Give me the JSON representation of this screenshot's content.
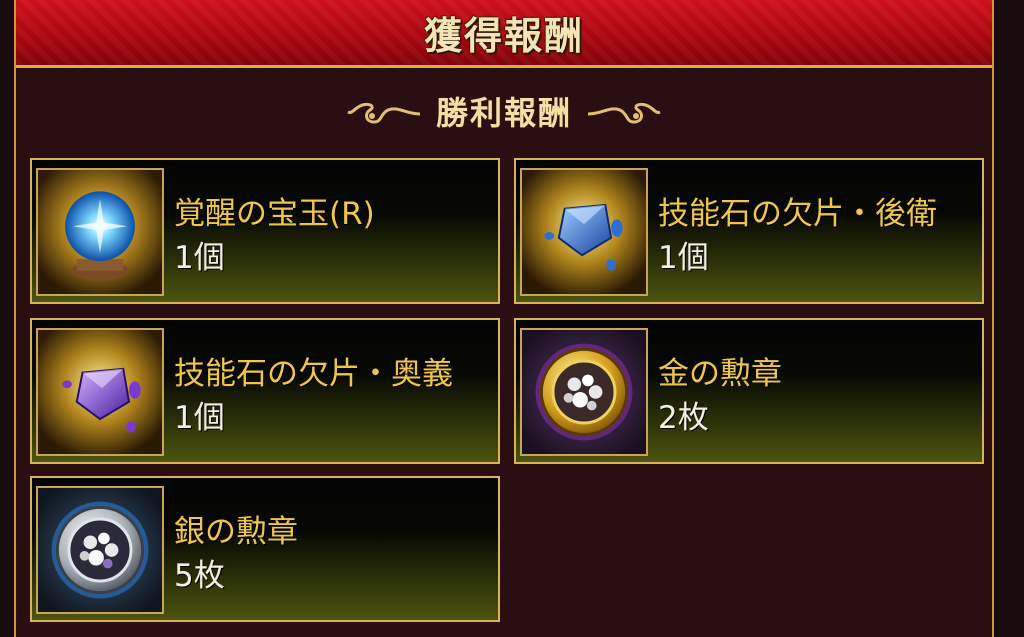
{
  "header": {
    "title": "獲得報酬"
  },
  "section": {
    "title": "勝利報酬"
  },
  "rewards": [
    {
      "name": "覚醒の宝玉(R)",
      "quantity": "1個",
      "icon": "blue-orb-icon"
    },
    {
      "name": "技能石の欠片・後衛",
      "quantity": "1個",
      "icon": "blue-crystal-icon"
    },
    {
      "name": "技能石の欠片・奥義",
      "quantity": "1個",
      "icon": "purple-crystal-icon"
    },
    {
      "name": "金の勲章",
      "quantity": "2枚",
      "icon": "gold-medal-icon"
    },
    {
      "name": "銀の勲章",
      "quantity": "5枚",
      "icon": "silver-medal-icon"
    }
  ],
  "colors": {
    "header_red": "#c00812",
    "gold_border": "#d7b35a",
    "item_name": "#f0c64a",
    "panel_bg": "#2a0f12"
  }
}
